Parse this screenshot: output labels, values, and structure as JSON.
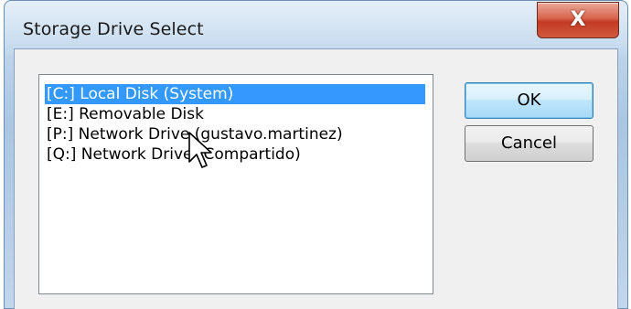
{
  "window": {
    "title": "Storage Drive Select",
    "close_glyph": "X"
  },
  "drives": {
    "items": [
      {
        "label": "[C:] Local Disk (System)",
        "selected": true
      },
      {
        "label": "[E:] Removable Disk",
        "selected": false
      },
      {
        "label": "[P:] Network Drive (gustavo.martinez)",
        "selected": false
      },
      {
        "label": "[Q:] Network Drive (Compartido)",
        "selected": false
      }
    ]
  },
  "buttons": {
    "ok_label": "OK",
    "cancel_label": "Cancel"
  },
  "colors": {
    "selection": "#3399ff",
    "close_button": "#c23a22"
  },
  "icons": {
    "close": "close-icon",
    "cursor": "mouse-pointer-icon"
  }
}
